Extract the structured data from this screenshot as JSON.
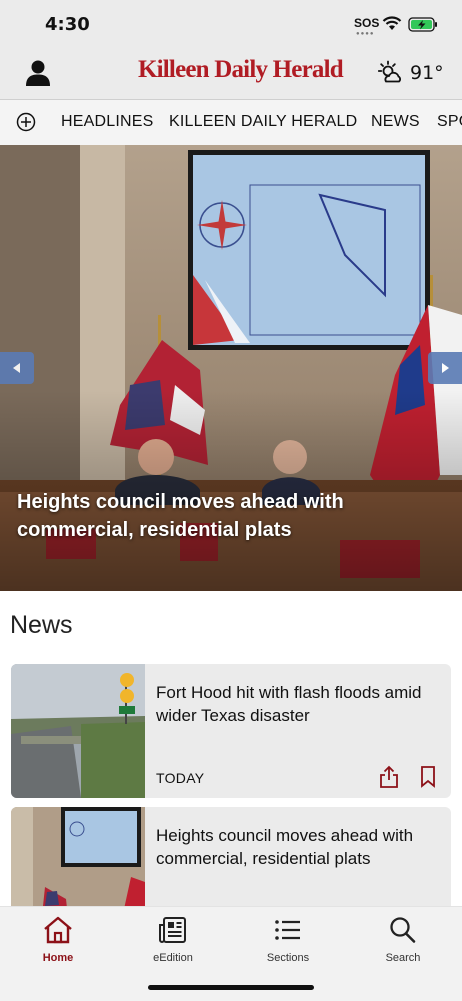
{
  "status_bar": {
    "time": "4:30",
    "carrier": "SOS"
  },
  "header": {
    "logo_text": "Killeen Daily Herald",
    "weather_temp": "91°"
  },
  "sections_nav": {
    "tabs": [
      "HEADLINES",
      "KILLEEN DAILY HERALD",
      "NEWS",
      "SPORTS"
    ]
  },
  "hero": {
    "title": "Heights council moves ahead with commercial, residential plats"
  },
  "news": {
    "heading": "News",
    "articles": [
      {
        "title": "Fort Hood hit with flash floods amid wider Texas disaster",
        "time": "TODAY"
      },
      {
        "title": "Heights council moves ahead with commercial, residential plats",
        "time": ""
      }
    ]
  },
  "tab_bar": {
    "items": [
      "Home",
      "eEdition",
      "Sections",
      "Search"
    ],
    "active": "Home"
  },
  "colors": {
    "brand": "#b01c24",
    "active_tab": "#8c1118",
    "carousel_arrow": "#5a7bb5"
  }
}
